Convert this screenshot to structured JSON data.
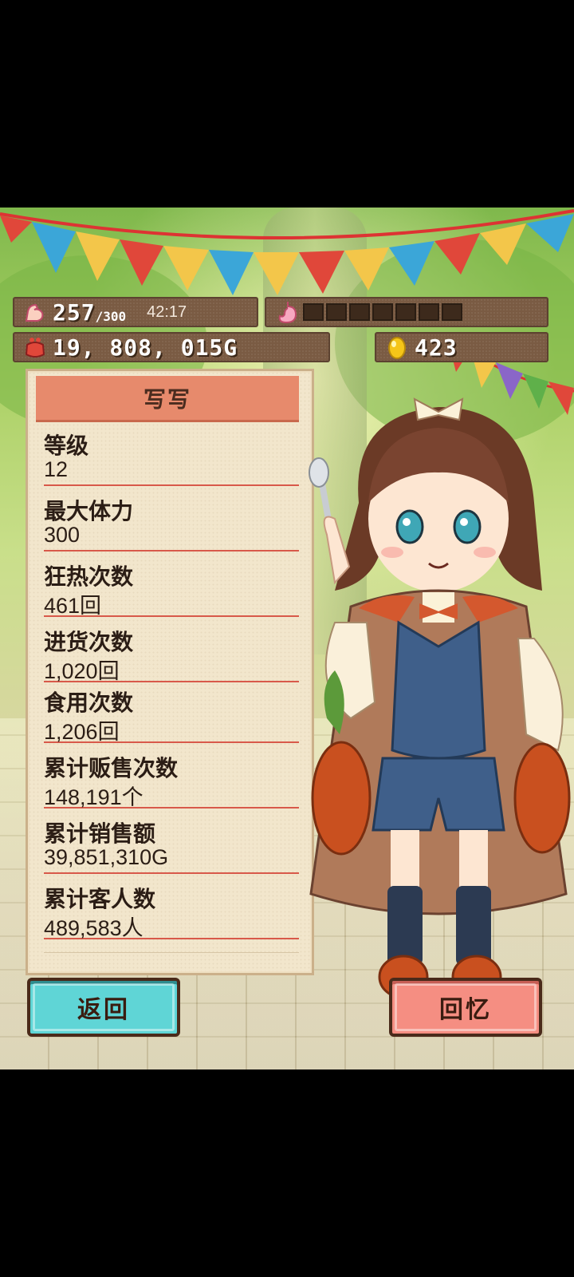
{
  "status": {
    "stamina_current": "257",
    "stamina_max": "/300",
    "timer": "42:17",
    "hunger_segments_total": 7,
    "hunger_segments_filled": 0,
    "gold": "19, 808, 015G",
    "eggs": "423"
  },
  "panel": {
    "title": "写写",
    "stats": [
      {
        "label": "等级",
        "value": "12"
      },
      {
        "label": "最大体力",
        "value": "300"
      },
      {
        "label": "狂热次数",
        "value": "461回"
      },
      {
        "label": "进货次数",
        "value": "1,020回"
      },
      {
        "label": "食用次数",
        "value": "1,206回"
      },
      {
        "label": "累计贩售次数",
        "value": "148,191个"
      },
      {
        "label": "累计销售额",
        "value": "39,851,310G"
      },
      {
        "label": "累计客人数",
        "value": "489,583人"
      }
    ]
  },
  "buttons": {
    "back": "返回",
    "memory": "回忆"
  },
  "icons": {
    "stamina": "flexed-arm-icon",
    "hunger": "stomach-icon",
    "gold": "purse-icon",
    "egg": "golden-egg-icon"
  },
  "colors": {
    "back_button": "#5fd5d6",
    "memory_button": "#f58e82",
    "panel_header": "#e78a6c",
    "divider": "#d8594a"
  }
}
